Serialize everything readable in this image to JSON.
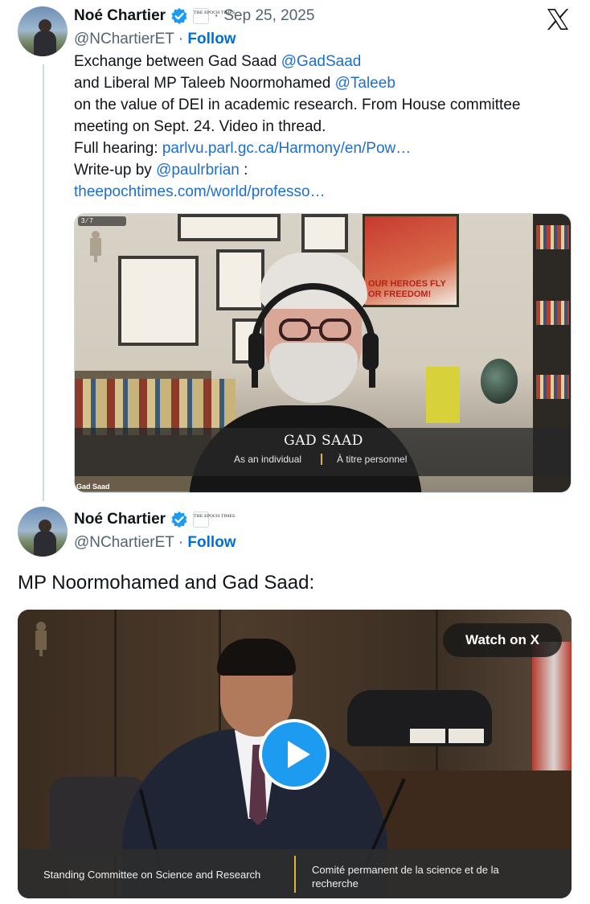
{
  "tweet1": {
    "author_name": "Noé Chartier",
    "handle": "@NChartierET",
    "follow_label": "Follow",
    "separator": "·",
    "date": "Sep 25, 2025",
    "org_badge_text": "THE EPOCH TIMES",
    "text": {
      "line1_prefix": "Exchange between Gad Saad ",
      "line1_mention": "@GadSaad",
      "line2_prefix": "and Liberal MP Taleeb Noormohamed ",
      "line2_mention": "@Taleeb",
      "line3": "on the value of DEI in academic research. From House committee",
      "line4": "meeting on Sept. 24. Video in thread.",
      "line5_prefix": "Full hearing: ",
      "line5_link": "parlvu.parl.gc.ca/Harmony/en/Pow…",
      "line6_prefix": "Write-up by ",
      "line6_mention": "@paulrbrian",
      "line6_suffix": " :",
      "line7_link": "theepochtimes.com/world/professo…"
    },
    "media": {
      "speaker_name": "GAD SAAD",
      "role_en": "As an individual",
      "role_fr": "À titre personnel",
      "camera_label": "Gad Saad",
      "cam_counts": "3 ⁄ 7",
      "poster_text": "OUR HEROES FLY\nOR FREEDOM!"
    }
  },
  "tweet2": {
    "author_name": "Noé Chartier",
    "handle": "@NChartierET",
    "follow_label": "Follow",
    "separator": "·",
    "org_badge_text": "THE EPOCH TIMES",
    "text": "MP Noormohamed and Gad Saad:",
    "media": {
      "watch_label": "Watch on X",
      "committee_en": "Standing Committee on Science and Research",
      "committee_fr": "Comité permanent de la science et de la recherche"
    }
  },
  "colors": {
    "link": "#1d6fce",
    "follow": "#006fd6",
    "play_button": "#1d9bf0",
    "accent_bar": "#e0b33a"
  },
  "icons": {
    "verified": "verified-badge-icon",
    "logo": "x-logo-icon",
    "play": "play-icon"
  }
}
